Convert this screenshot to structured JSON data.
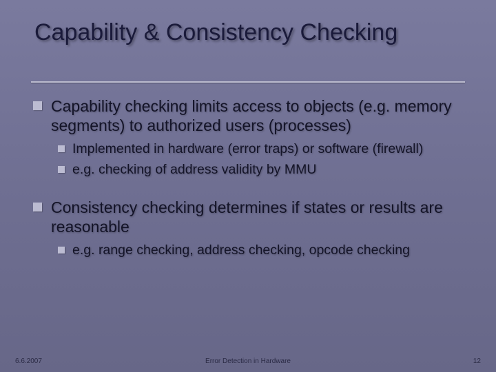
{
  "title": "Capability & Consistency Checking",
  "bullets": [
    {
      "level": 1,
      "text": "Capability checking limits access to objects (e.g. memory segments) to authorized users (processes)"
    },
    {
      "level": 2,
      "text": "Implemented in hardware (error traps) or software (firewall)"
    },
    {
      "level": 2,
      "text": "e.g. checking of address validity by MMU"
    },
    {
      "level": 0,
      "text": ""
    },
    {
      "level": 1,
      "text": "Consistency checking determines if states or results are reasonable"
    },
    {
      "level": 2,
      "text": "e.g. range checking, address checking, opcode checking"
    }
  ],
  "footer": {
    "date": "6.6.2007",
    "center": "Error Detection in Hardware",
    "page": "12"
  }
}
